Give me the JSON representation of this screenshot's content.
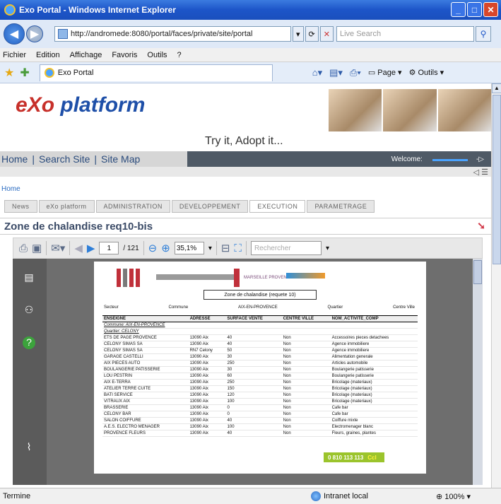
{
  "window": {
    "title": "Exo Portal - Windows Internet Explorer"
  },
  "browser": {
    "address": "http://andromede:8080/portal/faces/private/site/portal",
    "live_search_placeholder": "Live Search",
    "menu": [
      "Fichier",
      "Edition",
      "Affichage",
      "Favoris",
      "Outils",
      "?"
    ],
    "tab_title": "Exo Portal",
    "tools": {
      "page": "Page",
      "outils": "Outils"
    }
  },
  "portal": {
    "logo_e": "eXo",
    "logo_p": "platform",
    "slogan": "Try it, Adopt it...",
    "nav_links": [
      "Home",
      "|",
      "Search Site",
      "|",
      "Site Map"
    ],
    "welcome_label": "Welcome:",
    "breadcrumb": "Home",
    "tabs": [
      "News",
      "eXo platform",
      "ADMINISTRATION",
      "DEVELOPPEMENT",
      "EXECUTION",
      "PARAMETRAGE"
    ],
    "page_title": "Zone de chalandise req10-bis"
  },
  "pdf": {
    "page_current": "1",
    "page_total": "/ 121",
    "zoom": "35,1%",
    "search_placeholder": "Rechercher",
    "doc": {
      "header_text": "MARSEILLE PROVENCE",
      "zone_title": "Zone de chalandise (requete 10)",
      "meta": [
        "Secteur",
        "Commune",
        "AIX-EN-PROVENCE",
        "Quartier",
        "Centre Ville"
      ],
      "columns": [
        "ENSEIGNE",
        "ADRESSE",
        "SURFACE VENTE",
        "CENTRE VILLE",
        "NOM_ACTIVITE_COMP"
      ],
      "group_label": "Commune: AIX-EN-PROVENCE",
      "subgroup_label": "Quartier: CELONY",
      "rows": [
        [
          "ETS DE PAGE PROVENCE",
          "13090 Aix",
          "40",
          "Non",
          "Accessoires pieces detachees"
        ],
        [
          "CELONY SIMAS SA",
          "13090 Aix",
          "40",
          "Non",
          "Agence immobiliere"
        ],
        [
          "CELONY SIMAS SA",
          "RN7 Celony",
          "50",
          "Non",
          "Agence immobiliere"
        ],
        [
          "GARAGE CASTELLI",
          "13090 Aix",
          "30",
          "Non",
          "Alimentation generale"
        ],
        [
          "AIX PIECES AUTO",
          "13090 Aix",
          "250",
          "Non",
          "Articles automobile"
        ],
        [
          "BOULANGERIE PATISSERIE",
          "13090 Aix",
          "30",
          "Non",
          "Boulangerie patisserie"
        ],
        [
          "LOU PESTRIN",
          "13090 Aix",
          "60",
          "Non",
          "Boulangerie patisserie"
        ],
        [
          "AIX E-TERRA",
          "13090 Aix",
          "250",
          "Non",
          "Bricolage (materiaux)"
        ],
        [
          "ATELIER TERRE CUITE",
          "13090 Aix",
          "150",
          "Non",
          "Bricolage (materiaux)"
        ],
        [
          "BATI SERVICE",
          "13090 Aix",
          "120",
          "Non",
          "Bricolage (materiaux)"
        ],
        [
          "VITRAUX AIX",
          "13090 Aix",
          "100",
          "Non",
          "Bricolage (materiaux)"
        ],
        [
          "BRASSERIE",
          "13090 Aix",
          "0",
          "Non",
          "Cafe bar"
        ],
        [
          "CELONY BAR",
          "13090 Aix",
          "0",
          "Non",
          "Cafe bar"
        ],
        [
          "SALON COIFFURE",
          "13090 Aix",
          "40",
          "Non",
          "Coiffure mixte"
        ],
        [
          "A.E.S. ELECTRO MENAGER",
          "13090 Aix",
          "100",
          "Non",
          "Electromenager blanc"
        ],
        [
          "PROVENCE FLEURS",
          "13090 Aix",
          "40",
          "Non",
          "Fleurs, graines, plantes"
        ]
      ],
      "phone": "0 810 113 113",
      "phone_tail": "Ccl"
    }
  },
  "status": {
    "left": "Termine",
    "zone": "Intranet local",
    "zoom": "100%"
  }
}
